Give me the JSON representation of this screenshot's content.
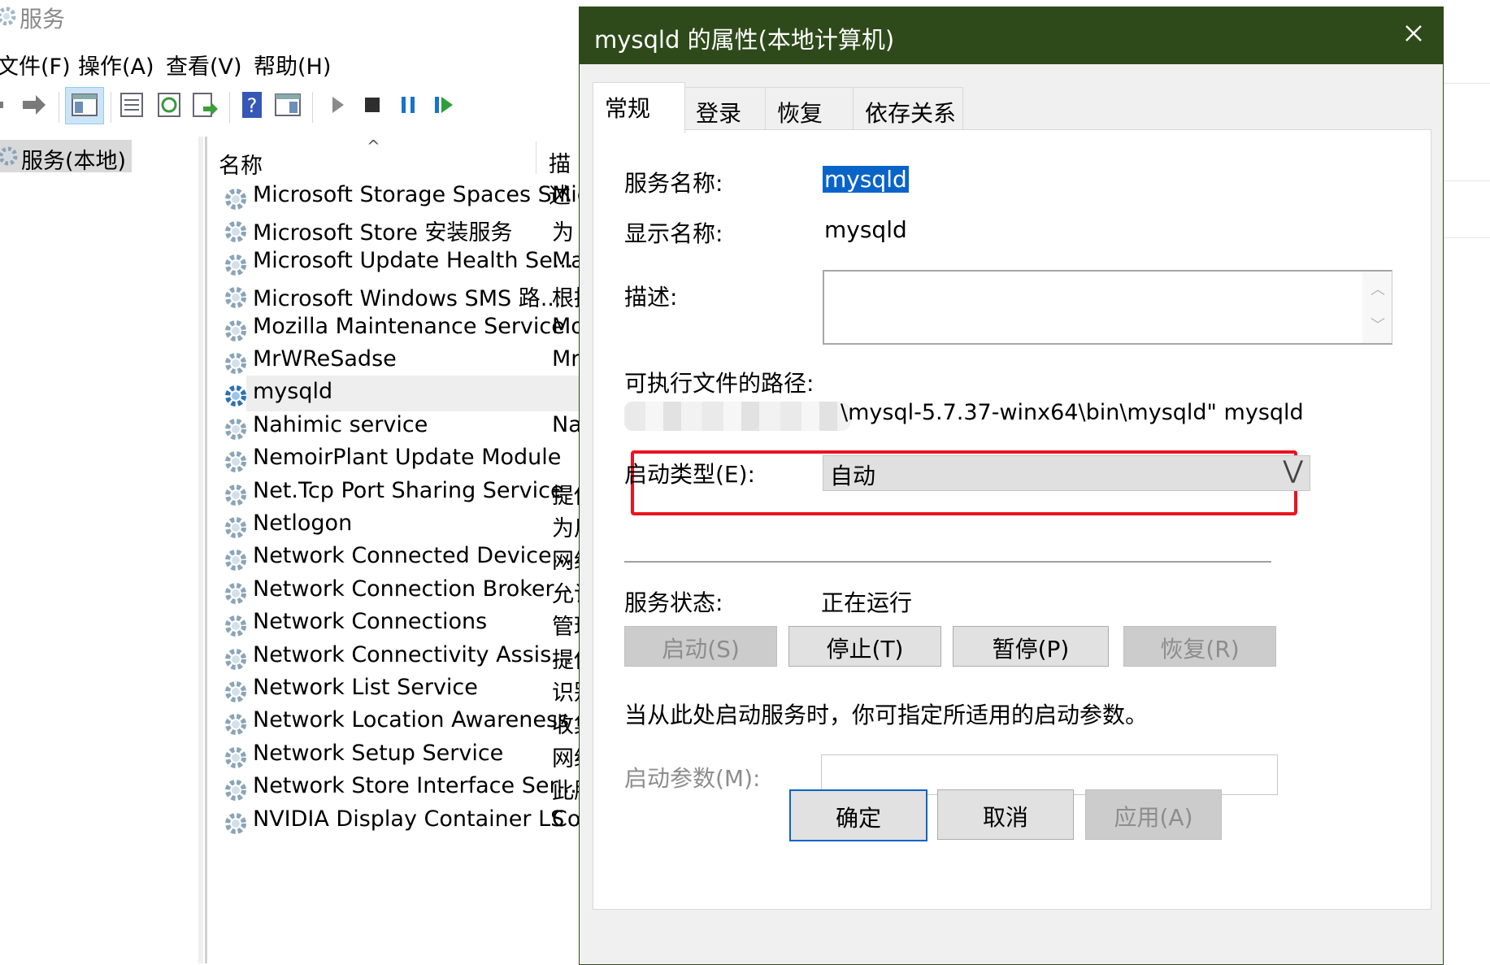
{
  "background_window": {
    "title": "服务",
    "menu": [
      "文件(F)",
      "操作(A)",
      "查看(V)",
      "帮助(H)"
    ],
    "tree_item": "服务(本地)",
    "columns": {
      "name": "名称",
      "description": "描述"
    },
    "services": [
      {
        "name": "Microsoft Storage Spaces S...",
        "desc": "Mic"
      },
      {
        "name": "Microsoft Store 安装服务",
        "desc": "为 I"
      },
      {
        "name": "Microsoft Update Health Se...",
        "desc": "Ma"
      },
      {
        "name": "Microsoft Windows SMS 路...",
        "desc": "根拼"
      },
      {
        "name": "Mozilla Maintenance Service",
        "desc": "Mo"
      },
      {
        "name": "MrWReSadse",
        "desc": "Mr"
      },
      {
        "name": "mysqld",
        "desc": ""
      },
      {
        "name": "Nahimic service",
        "desc": "Nal"
      },
      {
        "name": "NemoirPlant Update Module",
        "desc": ""
      },
      {
        "name": "Net.Tcp Port Sharing Service",
        "desc": "提供"
      },
      {
        "name": "Netlogon",
        "desc": "为用"
      },
      {
        "name": "Network Connected Device...",
        "desc": "网络"
      },
      {
        "name": "Network Connection Broker",
        "desc": "允许"
      },
      {
        "name": "Network Connections",
        "desc": "管理"
      },
      {
        "name": "Network Connectivity Assis...",
        "desc": "提供"
      },
      {
        "name": "Network List Service",
        "desc": "识别"
      },
      {
        "name": "Network Location Awareness",
        "desc": "收集"
      },
      {
        "name": "Network Setup Service",
        "desc": "网络"
      },
      {
        "name": "Network Store Interface Ser...",
        "desc": "此服"
      },
      {
        "name": "NVIDIA Display Container LS",
        "desc": "Cor"
      }
    ],
    "selected_service_index": 6
  },
  "dialog": {
    "title": "mysqld 的属性(本地计算机)",
    "tabs": [
      "常规",
      "登录",
      "恢复",
      "依存关系"
    ],
    "active_tab": 0,
    "service_name_label": "服务名称:",
    "service_name": "mysqld",
    "display_name_label": "显示名称:",
    "display_name": "mysqld",
    "description_label": "描述:",
    "description": "",
    "path_label": "可执行文件的路径:",
    "path_visible": "\\mysql-5.7.37-winx64\\bin\\mysqld\" mysqld",
    "startup_type_label": "启动类型(E):",
    "startup_type": "自动",
    "status_label": "服务状态:",
    "status": "正在运行",
    "buttons": [
      {
        "label": "启动(S)",
        "enabled": false
      },
      {
        "label": "停止(T)",
        "enabled": true
      },
      {
        "label": "暂停(P)",
        "enabled": true
      },
      {
        "label": "恢复(R)",
        "enabled": false
      }
    ],
    "hint": "当从此处启动服务时，你可指定所适用的启动参数。",
    "params_label": "启动参数(M):",
    "params_value": "",
    "footer": {
      "ok": "确定",
      "cancel": "取消",
      "apply": "应用(A)"
    },
    "title_bar_color": "#2e4a1a",
    "highlight_color": "#e8141f",
    "selection_color": "#0a64c8"
  }
}
